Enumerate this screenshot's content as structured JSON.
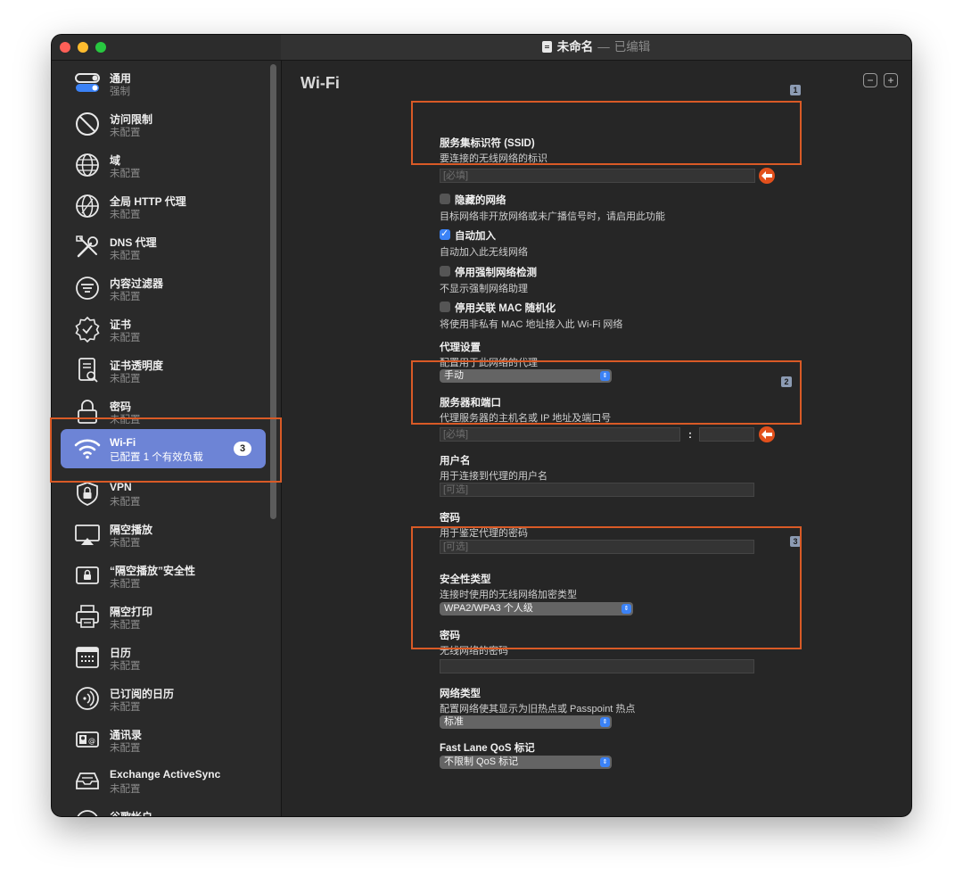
{
  "window": {
    "doc_title": "未命名",
    "separator": "—",
    "status": "已编辑"
  },
  "sidebar": {
    "items": [
      {
        "label": "通用",
        "sub": "强制",
        "icon": "toggle-icon"
      },
      {
        "label": "访问限制",
        "sub": "未配置",
        "icon": "prohibited-icon"
      },
      {
        "label": "域",
        "sub": "未配置",
        "icon": "globe-icon"
      },
      {
        "label": "全局 HTTP 代理",
        "sub": "未配置",
        "icon": "globe-network-icon"
      },
      {
        "label": "DNS 代理",
        "sub": "未配置",
        "icon": "tools-icon"
      },
      {
        "label": "内容过滤器",
        "sub": "未配置",
        "icon": "filter-icon"
      },
      {
        "label": "证书",
        "sub": "未配置",
        "icon": "certificate-badge-icon"
      },
      {
        "label": "证书透明度",
        "sub": "未配置",
        "icon": "document-search-icon"
      },
      {
        "label": "密码",
        "sub": "未配置",
        "icon": "lock-icon"
      },
      {
        "label": "Wi-Fi",
        "sub": "已配置 1 个有效负载",
        "icon": "wifi-icon",
        "badge": "3"
      },
      {
        "label": "VPN",
        "sub": "未配置",
        "icon": "vpn-lock-icon"
      },
      {
        "label": "隔空播放",
        "sub": "未配置",
        "icon": "airplay-icon"
      },
      {
        "label": "“隔空播放”安全性",
        "sub": "未配置",
        "icon": "airplay-lock-icon"
      },
      {
        "label": "隔空打印",
        "sub": "未配置",
        "icon": "printer-icon"
      },
      {
        "label": "日历",
        "sub": "未配置",
        "icon": "calendar-icon"
      },
      {
        "label": "已订阅的日历",
        "sub": "未配置",
        "icon": "broadcast-icon"
      },
      {
        "label": "通讯录",
        "sub": "未配置",
        "icon": "contacts-icon"
      },
      {
        "label": "Exchange ActiveSync",
        "sub": "未配置",
        "icon": "inbox-tray-icon"
      },
      {
        "label": "谷歌帐户",
        "sub": "",
        "icon": "google-account-icon"
      }
    ]
  },
  "main": {
    "title": "Wi-Fi",
    "minus": "−",
    "plus": "+",
    "markers": [
      "1",
      "2",
      "3"
    ],
    "ssid": {
      "label": "服务集标识符 (SSID)",
      "desc": "要连接的无线网络的标识",
      "placeholder": "[必填]"
    },
    "hidden": {
      "label": "隐藏的网络",
      "desc": "目标网络非开放网络或未广播信号时，请启用此功能",
      "checked": false
    },
    "auto_join": {
      "label": "自动加入",
      "desc": "自动加入此无线网络",
      "checked": true
    },
    "captive": {
      "label": "停用强制网络检测",
      "desc": "不显示强制网络助理",
      "checked": false
    },
    "mac": {
      "label": "停用关联 MAC 随机化",
      "desc": "将使用非私有 MAC 地址接入此 Wi-Fi 网络",
      "checked": false
    },
    "proxy": {
      "label": "代理设置",
      "desc": "配置用于此网络的代理",
      "value": "手动"
    },
    "server": {
      "label": "服务器和端口",
      "desc": "代理服务器的主机名或 IP 地址及端口号",
      "placeholder": "[必填]",
      "colon": ":"
    },
    "username": {
      "label": "用户名",
      "desc": "用于连接到代理的用户名",
      "placeholder": "[可选]"
    },
    "proxy_password": {
      "label": "密码",
      "desc": "用于鉴定代理的密码",
      "placeholder": "[可选]"
    },
    "security": {
      "label": "安全性类型",
      "desc": "连接时使用的无线网络加密类型",
      "value": "WPA2/WPA3 个人级"
    },
    "wifi_password": {
      "label": "密码",
      "desc": "无线网络的密码"
    },
    "network_type": {
      "label": "网络类型",
      "desc": "配置网络使其显示为旧热点或 Passpoint 热点",
      "value": "标准"
    },
    "qos": {
      "label": "Fast Lane QoS 标记",
      "value": "不限制 QoS 标记"
    }
  },
  "colors": {
    "accent_highlight": "#d95a26",
    "selection": "#6d84d6",
    "checkbox_on": "#3b82f6"
  }
}
